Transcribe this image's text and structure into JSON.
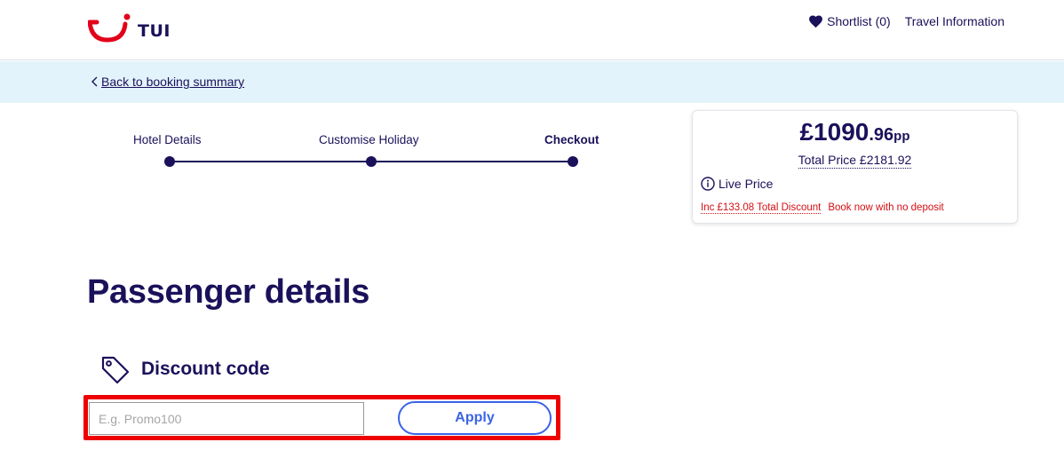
{
  "header": {
    "brand": "TUI",
    "shortlist_label": "Shortlist (0)",
    "travel_info_label": "Travel Information"
  },
  "backbar": {
    "back_label": "Back to booking summary"
  },
  "stepper": {
    "steps": [
      {
        "label": "Hotel Details",
        "active": false
      },
      {
        "label": "Customise Holiday",
        "active": false
      },
      {
        "label": "Checkout",
        "active": true
      }
    ]
  },
  "price_card": {
    "pp_currency_main": "£1090",
    "pp_decimal": ".96",
    "pp_suffix": "pp",
    "total_price": "Total Price £2181.92",
    "live_price": "Live Price",
    "discount_note": "Inc £133.08 Total Discount",
    "deposit_note": "Book now with no deposit"
  },
  "page": {
    "title": "Passenger details"
  },
  "discount": {
    "heading": "Discount code",
    "placeholder": "E.g. Promo100",
    "value": "",
    "apply_label": "Apply"
  },
  "colors": {
    "brand_navy": "#1a115a",
    "brand_red": "#e2001a",
    "backbar_bg": "#e3f3fb",
    "alert_red": "#d40e14",
    "apply_blue": "#3a64e6",
    "highlight_red": "#ee0000"
  },
  "icons": {
    "logo": "tui-smile-logo",
    "shortlist": "heart-icon",
    "back": "chevron-left-icon",
    "info": "info-circle-icon",
    "discount": "tag-icon"
  }
}
